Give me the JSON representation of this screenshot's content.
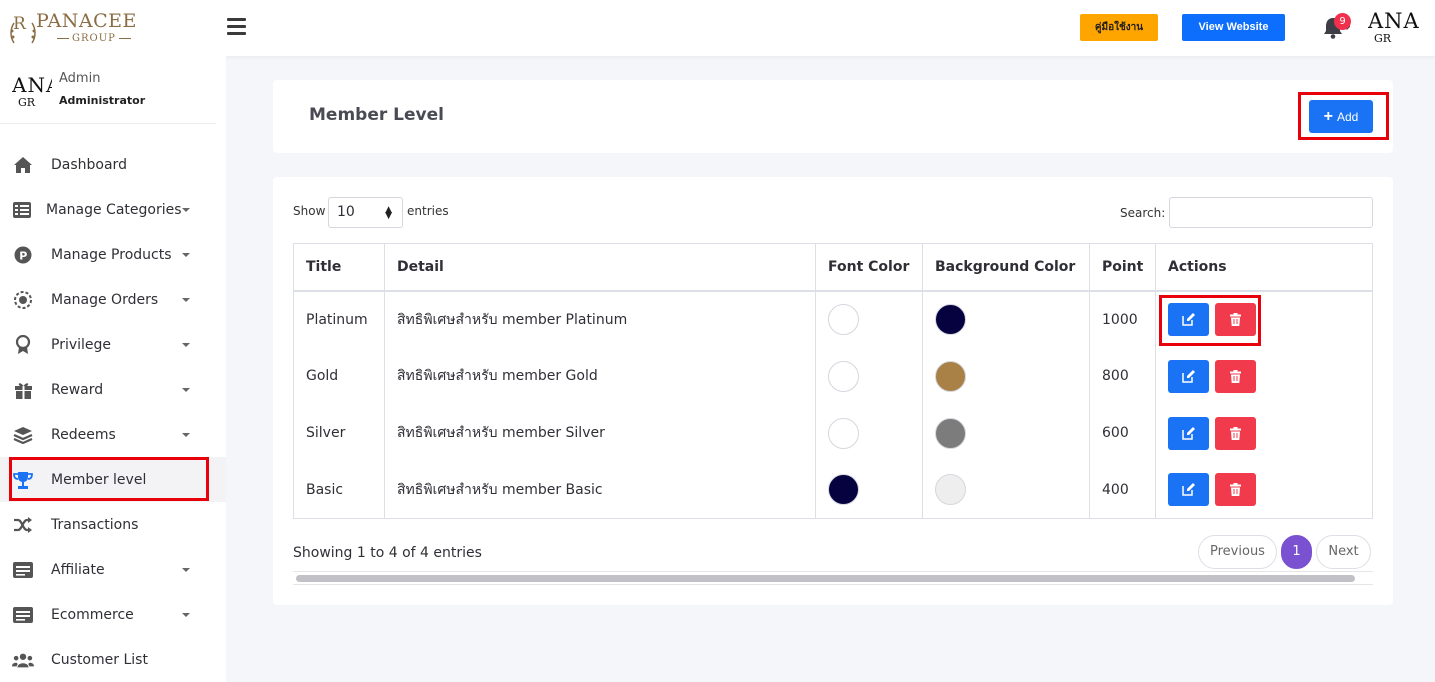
{
  "brand": {
    "name": "PANACEE",
    "sub": "GROUP",
    "avatar_big": "ANA",
    "avatar_small": "GR"
  },
  "topbar": {
    "manual_label": "คู่มือใช้งาน",
    "view_website_label": "View Website",
    "notifications": "9"
  },
  "user": {
    "role": "Admin",
    "title": "Administrator"
  },
  "sidebar": {
    "items": [
      {
        "label": "Dashboard",
        "icon": "home-icon",
        "caret": false
      },
      {
        "label": "Manage Categories",
        "icon": "list-icon",
        "caret": true
      },
      {
        "label": "Manage Products",
        "icon": "p-circle-icon",
        "caret": true
      },
      {
        "label": "Manage Orders",
        "icon": "orders-icon",
        "caret": true
      },
      {
        "label": "Privilege",
        "icon": "award-icon",
        "caret": true
      },
      {
        "label": "Reward",
        "icon": "gift-icon",
        "caret": true
      },
      {
        "label": "Redeems",
        "icon": "layers-icon",
        "caret": true
      },
      {
        "label": "Member level",
        "icon": "trophy-icon",
        "caret": false,
        "active": true
      },
      {
        "label": "Transactions",
        "icon": "shuffle-icon",
        "caret": false
      },
      {
        "label": "Affiliate",
        "icon": "id-card-icon",
        "caret": true
      },
      {
        "label": "Ecommerce",
        "icon": "id-card-icon",
        "caret": true
      },
      {
        "label": "Customer List",
        "icon": "users-icon",
        "caret": false
      }
    ]
  },
  "page": {
    "title": "Member Level",
    "add_label": "Add"
  },
  "table": {
    "show_label": "Show",
    "page_size": "10",
    "entries_label": "entries",
    "search_label": "Search:",
    "columns": [
      "Title",
      "Detail",
      "Font Color",
      "Background Color",
      "Point",
      "Actions"
    ],
    "rows": [
      {
        "title": "Platinum",
        "detail": "สิทธิพิเศษสำหรับ member Platinum",
        "font_color": "#ffffff",
        "bg_color": "#05023f",
        "point": "1000"
      },
      {
        "title": "Gold",
        "detail": "สิทธิพิเศษสำหรับ member Gold",
        "font_color": "#ffffff",
        "bg_color": "#a98046",
        "point": "800"
      },
      {
        "title": "Silver",
        "detail": "สิทธิพิเศษสำหรับ member Silver",
        "font_color": "#ffffff",
        "bg_color": "#7c7c7c",
        "point": "600"
      },
      {
        "title": "Basic",
        "detail": "สิทธิพิเศษสำหรับ member Basic",
        "font_color": "#05023f",
        "bg_color": "#eeeeee",
        "point": "400"
      }
    ],
    "info": "Showing 1 to 4 of 4 entries",
    "pagination": {
      "previous": "Previous",
      "current": "1",
      "next": "Next"
    }
  },
  "colors": {
    "primary": "#1a73f5",
    "danger": "#f23a4d",
    "warning": "#ffa500",
    "page_active": "#7a51d0",
    "highlight": "#e8000b"
  }
}
